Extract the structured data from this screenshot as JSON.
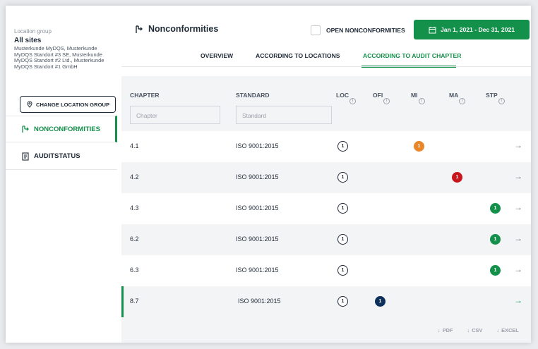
{
  "sidebar": {
    "location_label": "Location group",
    "location_title": "All sites",
    "location_sites": "Musterkunde MyDQS, Musterkunde MyDQS Standort #3 SE, Musterkunde MyDQS Standort #2 Ltd., Musterkunde MyDQS Standort #1 GmbH",
    "change_button": "CHANGE LOCATION GROUP",
    "nav": [
      {
        "label": "NONCONFORMITIES",
        "icon": "nonconformity-icon",
        "active": true
      },
      {
        "label": "AUDITSTATUS",
        "icon": "document-list-icon",
        "active": false
      }
    ]
  },
  "header": {
    "title": "Nonconformities",
    "open_nonconformities_label": "OPEN NONCONFORMITIES",
    "date_range": "Jan 1, 2021 - Dec 31, 2021",
    "tabs": [
      {
        "label": "OVERVIEW",
        "active": false
      },
      {
        "label": "ACCORDING TO LOCATIONS",
        "active": false
      },
      {
        "label": "ACCORDING TO AUDIT CHAPTER",
        "active": true
      }
    ]
  },
  "table": {
    "columns": {
      "chapter": "CHAPTER",
      "standard": "STANDARD",
      "loc": "LOC",
      "ofi": "OFI",
      "mi": "MI",
      "ma": "MA",
      "stp": "STP",
      "info": "i"
    },
    "placeholders": {
      "chapter": "Chapter",
      "standard": "Standard"
    },
    "rows": [
      {
        "chapter": "4.1",
        "standard": "ISO 9001:2015",
        "loc": "1",
        "ofi": "",
        "mi": "1",
        "ma": "",
        "stp": "",
        "arrow": "→"
      },
      {
        "chapter": "4.2",
        "standard": "ISO 9001:2015",
        "loc": "1",
        "ofi": "",
        "mi": "",
        "ma": "1",
        "stp": "",
        "arrow": "→"
      },
      {
        "chapter": "4.3",
        "standard": "ISO 9001:2015",
        "loc": "1",
        "ofi": "",
        "mi": "",
        "ma": "",
        "stp": "1",
        "arrow": "→"
      },
      {
        "chapter": "6.2",
        "standard": "ISO 9001:2015",
        "loc": "1",
        "ofi": "",
        "mi": "",
        "ma": "",
        "stp": "1",
        "arrow": "→"
      },
      {
        "chapter": "6.3",
        "standard": "ISO 9001:2015",
        "loc": "1",
        "ofi": "",
        "mi": "",
        "ma": "",
        "stp": "1",
        "arrow": "→"
      },
      {
        "chapter": "8.7",
        "standard": "ISO 9001:2015",
        "loc": "1",
        "ofi": "1",
        "mi": "",
        "ma": "",
        "stp": "",
        "arrow": "→"
      }
    ]
  },
  "exports": {
    "pdf": "PDF",
    "csv": "CSV",
    "excel": "EXCEL",
    "download_glyph": "↓"
  },
  "colors": {
    "accent": "#13904a",
    "mi": "#e8862a",
    "ma": "#c8161d",
    "stp": "#13904a",
    "ofi": "#0d2f5c"
  }
}
